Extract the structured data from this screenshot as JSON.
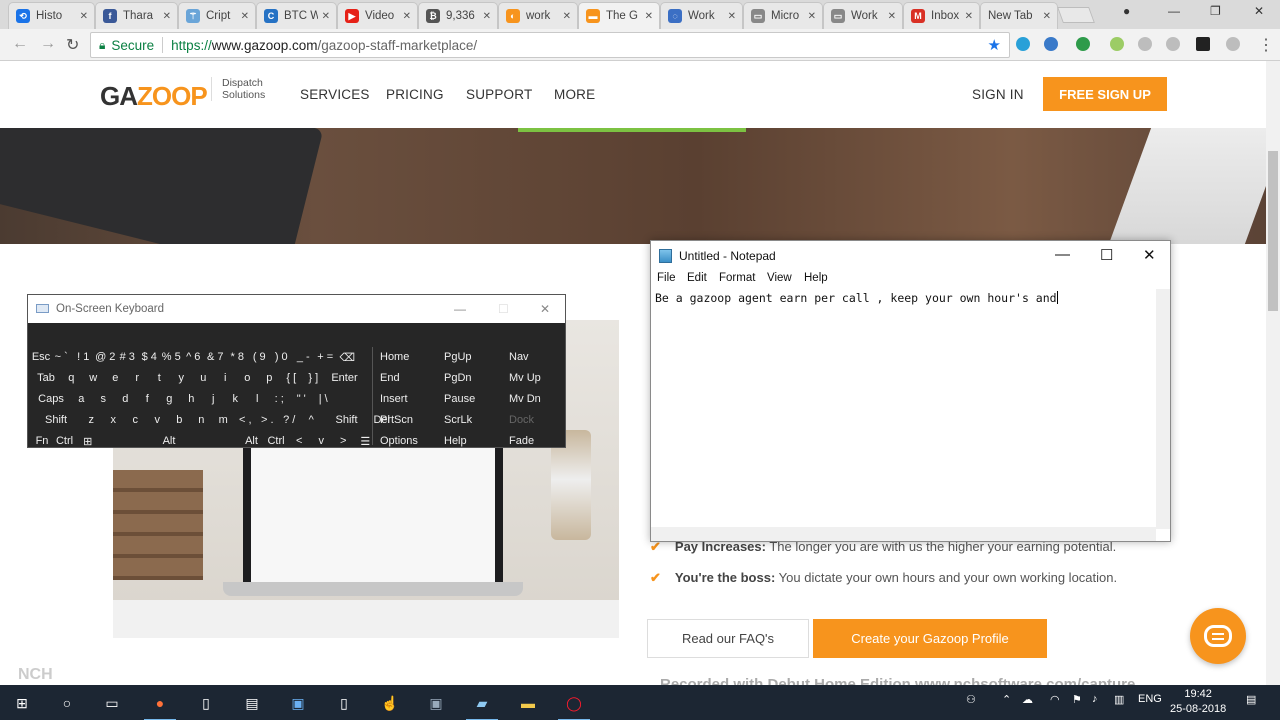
{
  "browser": {
    "tabs": [
      {
        "title": "Histo",
        "color": "#1a73e8",
        "glyph": "⟲"
      },
      {
        "title": "Thara",
        "color": "#3b5998",
        "glyph": "f"
      },
      {
        "title": "Cript",
        "color": "#6aa5d8",
        "glyph": "⚚"
      },
      {
        "title": "BTC W",
        "color": "#2672c4",
        "glyph": "C"
      },
      {
        "title": "Video",
        "color": "#e62117",
        "glyph": "▶"
      },
      {
        "title": "9,336",
        "color": "#555555",
        "glyph": "₿"
      },
      {
        "title": "work",
        "color": "#f7941d",
        "glyph": "◐"
      },
      {
        "title": "The G",
        "color": "#f7941d",
        "glyph": "▬"
      },
      {
        "title": "Work",
        "color": "#3b6fc4",
        "glyph": "◌"
      },
      {
        "title": "Micro",
        "color": "#888888",
        "glyph": "▭"
      },
      {
        "title": "Work",
        "color": "#888888",
        "glyph": "▭"
      },
      {
        "title": "Inbox",
        "color": "#d93025",
        "glyph": "M"
      },
      {
        "title": "New Tab",
        "color": "",
        "glyph": ""
      }
    ],
    "active_tab_index": 7,
    "address": {
      "secure_label": "Secure",
      "url_scheme": "https://",
      "url_host": "www.gazoop.com",
      "url_path": "/gazoop-staff-marketplace/"
    }
  },
  "site": {
    "logo_left": "GA",
    "logo_right": "ZOOP",
    "tagline": "Dispatch Solutions",
    "nav": [
      "SERVICES",
      "PRICING",
      "SUPPORT",
      "MORE"
    ],
    "sign_in": "SIGN IN",
    "signup": "FREE SIGN UP",
    "features": [
      {
        "title": "Pay Increases:",
        "text": " The longer you are with us the higher your earning potential."
      },
      {
        "title": "You're the boss:",
        "text": " You dictate your own hours and your own working location."
      }
    ],
    "faq_button": "Read our FAQ's",
    "profile_button": "Create your Gazoop Profile",
    "watermark": "Recorded with Debut Home Edition www.nchsoftware.com/capture",
    "nch_logo": "NCH"
  },
  "osk": {
    "title": "On-Screen Keyboard",
    "rows": [
      [
        "Esc",
        "~ `",
        "! 1",
        "@ 2",
        "# 3",
        "$ 4",
        "% 5",
        "^ 6",
        "& 7",
        "* 8",
        "( 9",
        ") 0",
        "_ -",
        "+ =",
        "⌫"
      ],
      [
        "Tab",
        "q",
        "w",
        "e",
        "r",
        "t",
        "y",
        "u",
        "i",
        "o",
        "p",
        "{ [",
        "} ]",
        "Enter"
      ],
      [
        "Caps",
        "a",
        "s",
        "d",
        "f",
        "g",
        "h",
        "j",
        "k",
        "l",
        ": ;",
        "\" '",
        "| \\"
      ],
      [
        "Shift",
        "z",
        "x",
        "c",
        "v",
        "b",
        "n",
        "m",
        "< ,",
        "> .",
        "? /",
        "^",
        "Shift",
        "Del"
      ],
      [
        "Fn",
        "Ctrl",
        "⊞",
        "Alt",
        "Alt",
        "Ctrl",
        "<",
        "v",
        ">",
        "☰"
      ]
    ],
    "nav_keys": [
      [
        "Home",
        "PgUp",
        "Nav"
      ],
      [
        "End",
        "PgDn",
        "Mv Up"
      ],
      [
        "Insert",
        "Pause",
        "Mv Dn"
      ],
      [
        "PrtScn",
        "ScrLk",
        "Dock"
      ],
      [
        "Options",
        "Help",
        "Fade"
      ]
    ]
  },
  "notepad": {
    "title": "Untitled - Notepad",
    "menu": [
      "File",
      "Edit",
      "Format",
      "View",
      "Help"
    ],
    "text": "Be a gazoop agent earn per call , keep your own hour's and"
  },
  "taskbar": {
    "tray_lang": "ENG",
    "time": "19:42",
    "date": "25-08-2018"
  },
  "colors": {
    "brand_orange": "#f7941d",
    "secure_green": "#0b8043",
    "taskbar": "#1c2633"
  }
}
